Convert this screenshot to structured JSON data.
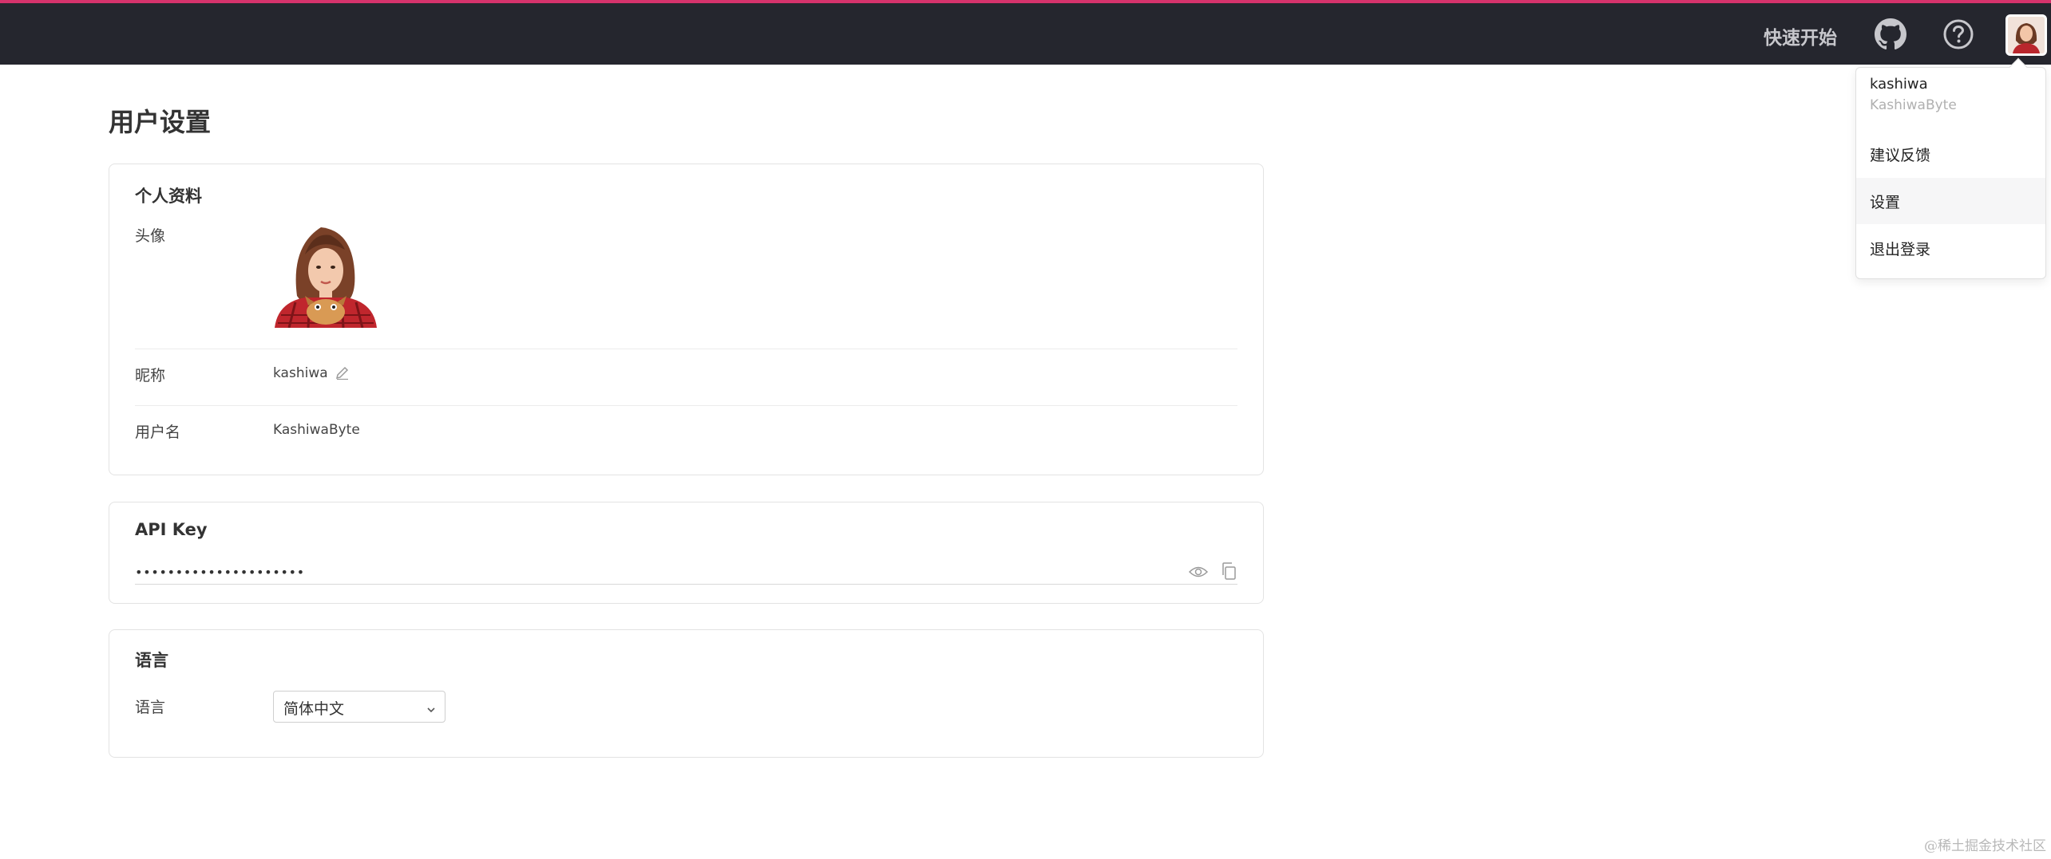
{
  "topbar": {
    "quickstart_label": "快速开始",
    "accent_color": "#d6336c",
    "background_color": "#25262e",
    "icons": [
      "github-icon",
      "help-icon",
      "avatar"
    ]
  },
  "page": {
    "title": "用户设置"
  },
  "profile": {
    "section_title": "个人资料",
    "avatar_label": "头像",
    "nickname_label": "昵称",
    "nickname_value": "kashiwa",
    "username_label": "用户名",
    "username_value": "KashiwaByte"
  },
  "api": {
    "section_title": "API Key",
    "masked_value": "•••••••••••••••••••••"
  },
  "language": {
    "section_title": "语言",
    "field_label": "语言",
    "selected_value": "简体中文"
  },
  "user_menu": {
    "display_name": "kashiwa",
    "handle": "KashiwaByte",
    "items": [
      {
        "label": "建议反馈"
      },
      {
        "label": "设置"
      },
      {
        "label": "退出登录"
      }
    ]
  },
  "watermark": "@稀土掘金技术社区"
}
